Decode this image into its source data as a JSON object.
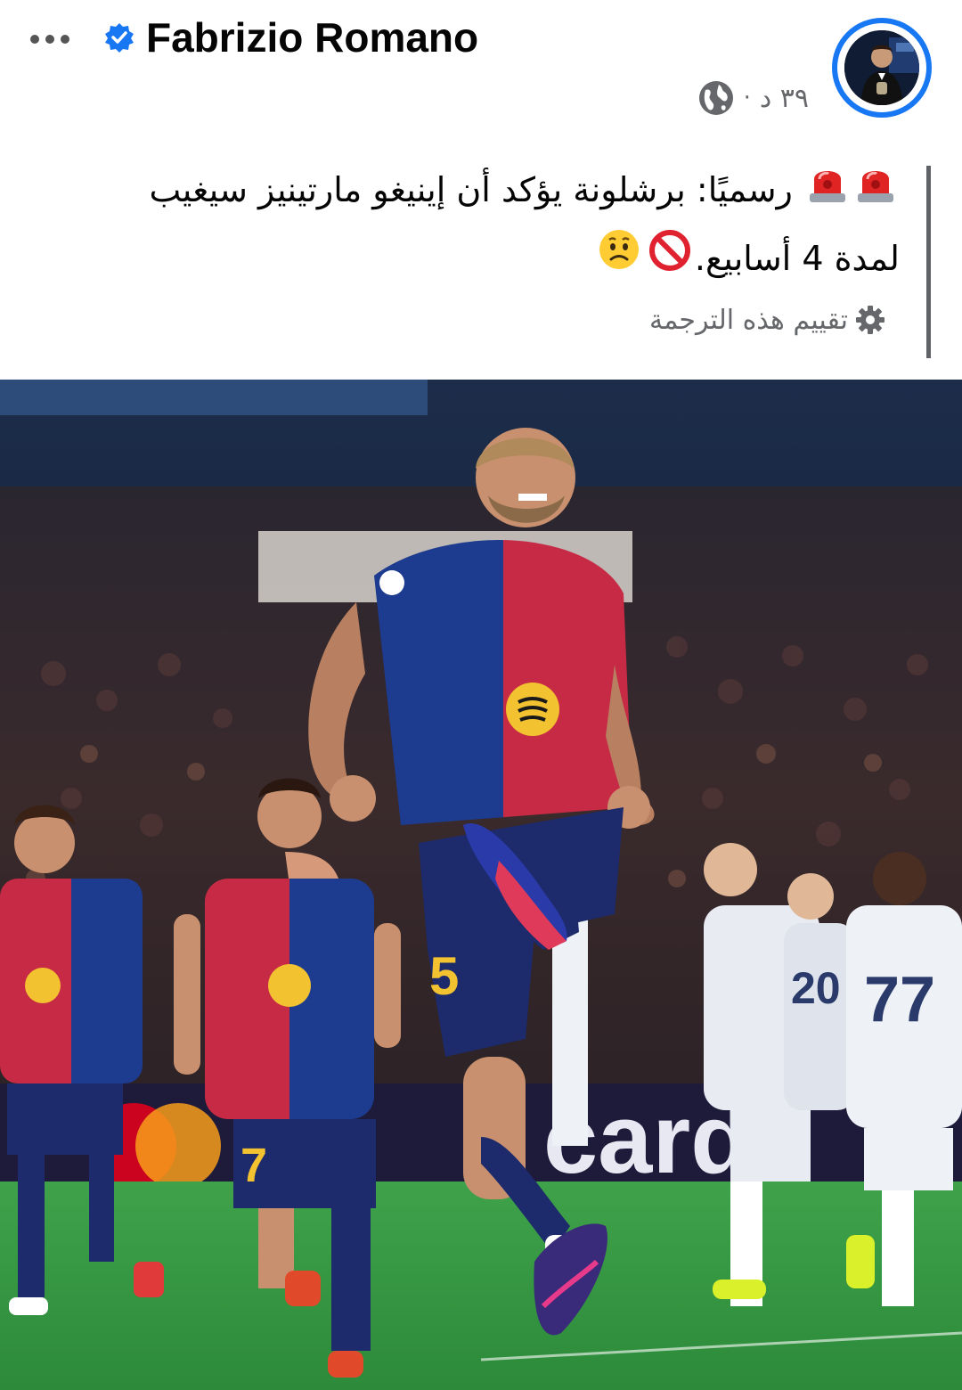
{
  "post": {
    "author": "Fabrizio Romano",
    "verified": true,
    "time": "٣٩ د",
    "separator": "·",
    "audience_icon": "globe-icon",
    "text_line1": "رسميًا: برشلونة يؤكد أن إينيغو مارتينيز سيغيب",
    "text_line2": "لمدة 4 أسابيع.",
    "emojis_line1": [
      "rotating-light-emoji",
      "rotating-light-emoji"
    ],
    "emojis_line2": [
      "no-entry-emoji",
      "worried-face-emoji"
    ],
    "rate_translation": "تقييم هذه الترجمة",
    "photo": {
      "description_icon": "football-celebration-photo",
      "shirt_numbers": [
        "5",
        "7",
        "77",
        "20"
      ],
      "board_text": "card"
    }
  },
  "colors": {
    "accent": "#1877f2",
    "secondary_text": "#65676b",
    "barca_blue": "#1a3a8a",
    "barca_red": "#c41e3a"
  }
}
